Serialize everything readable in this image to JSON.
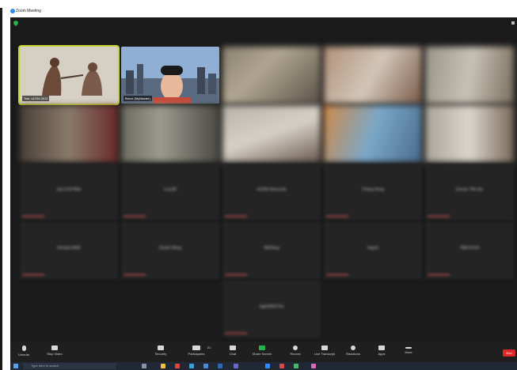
{
  "window": {
    "title": "Zoom Meeting"
  },
  "participants": [
    {
      "name": "",
      "sub": "Tsai, s1234-0012"
    },
    {
      "name": "",
      "sub": "Bruce (MyMaster)"
    },
    {
      "name": "",
      "sub": ""
    },
    {
      "name": "",
      "sub": ""
    },
    {
      "name": "",
      "sub": ""
    },
    {
      "name": "",
      "sub": ""
    },
    {
      "name": "",
      "sub": ""
    },
    {
      "name": "",
      "sub": ""
    },
    {
      "name": "",
      "sub": ""
    },
    {
      "name": "",
      "sub": ""
    },
    {
      "name": "spa 51974Wu",
      "sub": ""
    },
    {
      "name": "Lucy90",
      "sub": ""
    },
    {
      "name": "4100A Interscale",
      "sub": ""
    },
    {
      "name": "Chang Hong",
      "sub": ""
    },
    {
      "name": "Emma 79N Siu",
      "sub": ""
    },
    {
      "name": "Rossita 8400",
      "sub": ""
    },
    {
      "name": "Daniel Wang",
      "sub": ""
    },
    {
      "name": "9800ang",
      "sub": ""
    },
    {
      "name": "Sagmi",
      "sub": ""
    },
    {
      "name": "788ChiTeH",
      "sub": ""
    },
    {
      "name": "Iggle0830 Kiu",
      "sub": ""
    }
  ],
  "toolbar": {
    "unmute": "Unmute",
    "stop_video": "Stop Video",
    "security": "Security",
    "participants": "Participants",
    "participants_count": "21",
    "chat": "Chat",
    "share_screen": "Share Screen",
    "record": "Record",
    "live_transcript": "Live Transcript",
    "reactions": "Reactions",
    "apps": "Apps",
    "more": "More",
    "end": "End"
  },
  "taskbar": {
    "search_placeholder": "Type here to search"
  },
  "colors": {
    "meeting_bg": "#1a1a1a",
    "active_speaker": "#c6d531",
    "share_green": "#27b34a",
    "end_red": "#e02828"
  }
}
